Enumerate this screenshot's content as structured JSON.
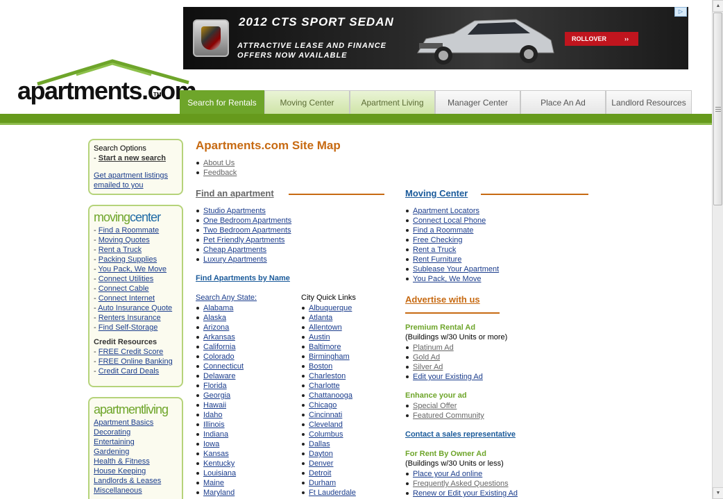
{
  "header": {
    "logo_text": "apartments.com",
    "logo_tm": "TM",
    "ad": {
      "title": "2012 CTS SPORT SEDAN",
      "subtitle_line1": "ATTRACTIVE LEASE AND FINANCE",
      "subtitle_line2": "OFFERS NOW AVAILABLE",
      "rollover": "ROLLOVER",
      "rollover_arrow": "››",
      "info_icon": "ad-choices-icon"
    },
    "nav_tabs": [
      {
        "label": "Search for Rentals"
      },
      {
        "label": "Moving Center"
      },
      {
        "label": "Apartment Living"
      },
      {
        "label": "Manager Center"
      },
      {
        "label": "Place An Ad"
      },
      {
        "label": "Landlord Resources"
      }
    ]
  },
  "sidebar": {
    "search_options": {
      "title": "Search Options",
      "dash": "- ",
      "start_new": "Start a new search",
      "get_listings_line1": "Get apartment listings",
      "get_listings_line2": "emailed to you"
    },
    "moving_center": {
      "logo_a": "moving",
      "logo_b": "center",
      "items": [
        "Find a Roommate",
        "Moving Quotes",
        "Rent a Truck",
        "Packing Supplies",
        "You Pack, We Move",
        "Connect Utilities",
        "Connect Cable",
        "Connect Internet",
        "Auto Insurance Quote",
        "Renters Insurance",
        "Find Self-Storage"
      ],
      "credit_title": "Credit Resources",
      "credit_items": [
        "FREE Credit Score",
        "FREE Online Banking",
        "Credit Card Deals"
      ]
    },
    "apartment_living": {
      "logo_a": "apartment",
      "logo_b": "living",
      "items": [
        "Apartment Basics",
        "Decorating",
        "Entertaining",
        "Gardening",
        "Health & Fitness",
        "House Keeping",
        "Landlords & Leases",
        "Miscellaneous"
      ]
    }
  },
  "main": {
    "title": "Apartments.com Site Map",
    "top_links": [
      "About Us",
      "Feedback"
    ],
    "find_apartment": {
      "heading": "Find an apartment",
      "items": [
        "Studio Apartments",
        "One Bedroom Apartments",
        "Two Bedroom Apartments",
        "Pet Friendly Apartments",
        "Cheap Apartments",
        "Luxury Apartments"
      ],
      "by_name": "Find Apartments by Name",
      "search_state": "Search Any State:",
      "states": [
        "Alabama",
        "Alaska",
        "Arizona",
        "Arkansas",
        "California",
        "Colorado",
        "Connecticut",
        "Delaware",
        "Florida",
        "Georgia",
        "Hawaii",
        "Idaho",
        "Illinois",
        "Indiana",
        "Iowa",
        "Kansas",
        "Kentucky",
        "Louisiana",
        "Maine",
        "Maryland"
      ],
      "city_title": "City Quick Links",
      "cities": [
        "Albuquerque",
        "Atlanta",
        "Allentown",
        "Austin",
        "Baltimore",
        "Birmingham",
        "Boston",
        "Charleston",
        "Charlotte",
        "Chattanooga",
        "Chicago",
        "Cincinnati",
        "Cleveland",
        "Columbus",
        "Dallas",
        "Dayton",
        "Denver",
        "Detroit",
        "Durham",
        "Ft Lauderdale"
      ]
    },
    "moving_center": {
      "heading": "Moving Center",
      "items": [
        "Apartment Locators",
        "Connect Local Phone",
        "Find a Roommate",
        "Free Checking",
        "Rent a Truck",
        "Rent Furniture",
        "Sublease Your Apartment",
        "You Pack, We Move"
      ]
    },
    "advertise": {
      "heading": "Advertise with us",
      "premium_title": "Premium Rental Ad",
      "premium_note": "(Buildings w/30 Units or more)",
      "premium_items": [
        "Platinum Ad",
        "Gold Ad",
        "Silver Ad",
        "Edit your Existing Ad"
      ],
      "enhance_title": "Enhance your ad",
      "enhance_items": [
        "Special Offer",
        "Featured Community"
      ],
      "contact": "Contact a sales representative",
      "owner_title": "For Rent By Owner Ad",
      "owner_note": "(Buildings w/30 Units or less)",
      "owner_items": [
        "Place your Ad online",
        "Frequently Asked Questions",
        "Renew or Edit your Existing Ad"
      ]
    }
  },
  "scrollbar": {
    "up": "▲",
    "down": "▼"
  },
  "colors": {
    "brand_green": "#669a1c",
    "accent_orange": "#c76a12",
    "link_blue": "#1a3c8c"
  }
}
